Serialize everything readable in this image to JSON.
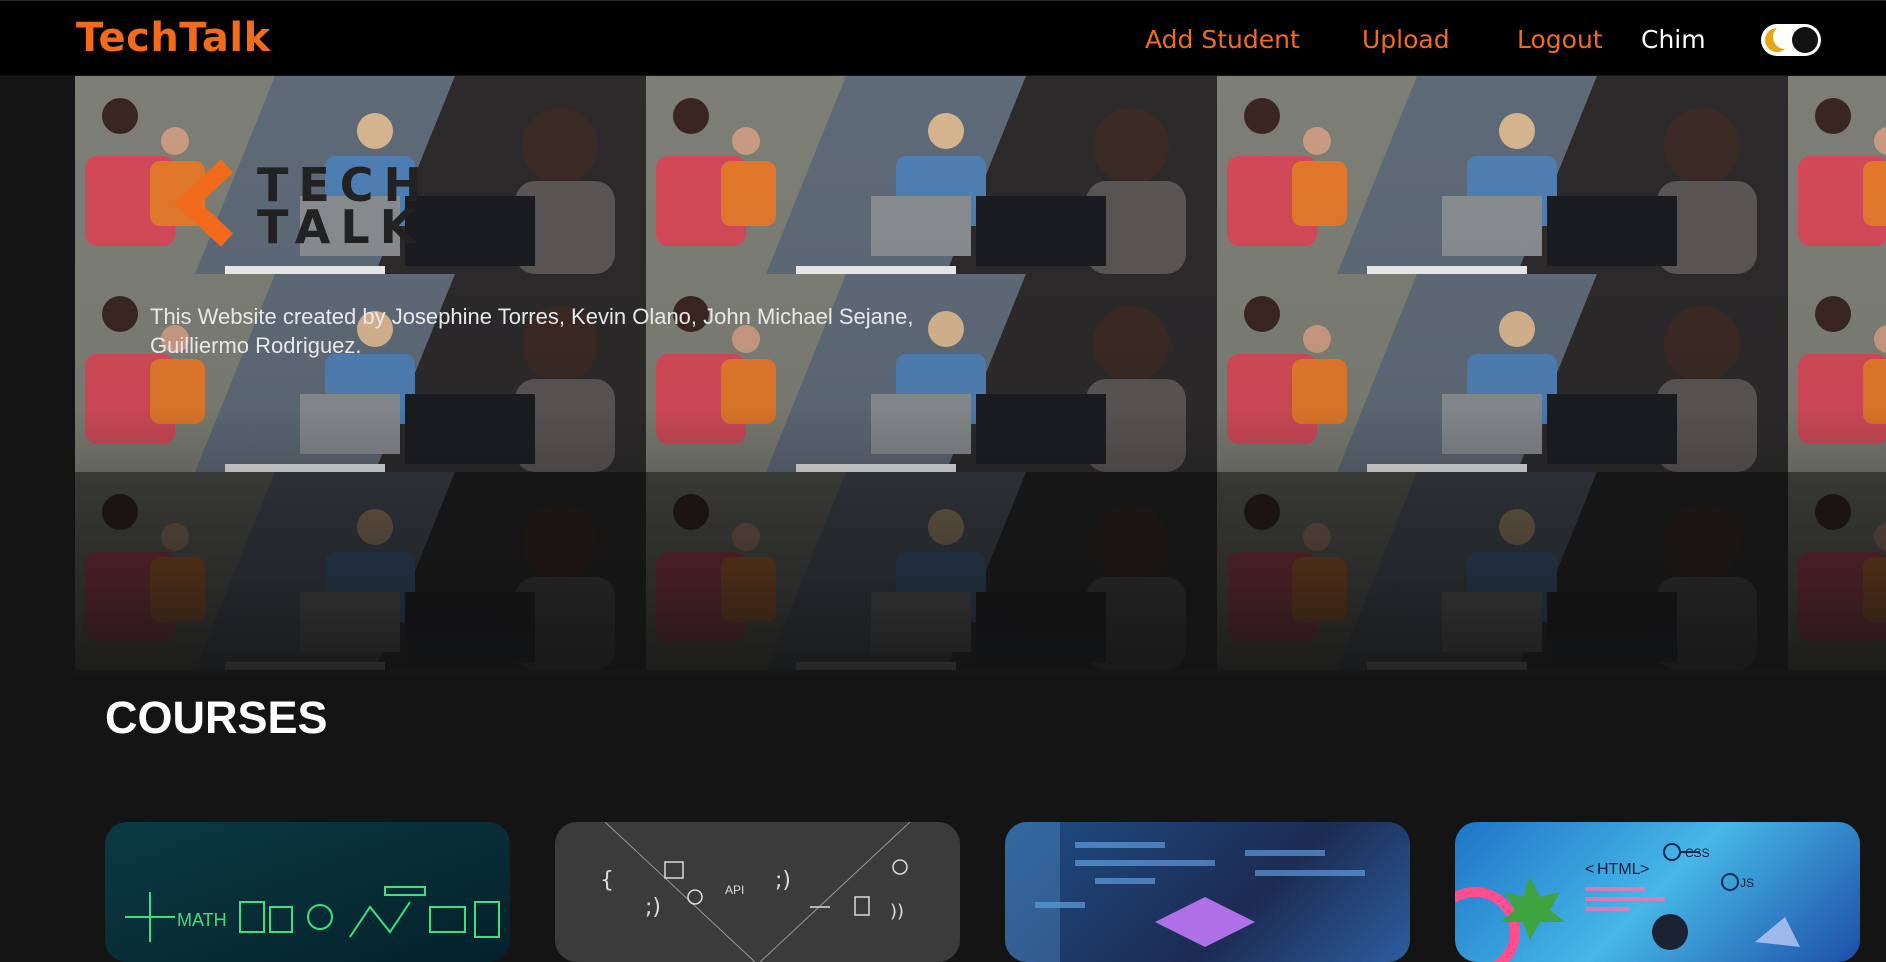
{
  "navbar": {
    "brand": "TechTalk",
    "links": [
      "Add Student",
      "Upload",
      "Logout"
    ],
    "user_name": "Chim",
    "theme_toggle": {
      "state": "dark",
      "icon": "moon-icon"
    }
  },
  "hero": {
    "logo_text": "TECH TALK",
    "credit": "This Website created by Josephine Torres, Kevin Olano, John Michael Sejane, Guilliermo Rodriguez."
  },
  "courses": {
    "title": "COURSES",
    "cards": [
      {
        "label": "MATH"
      },
      {
        "label": "API"
      },
      {
        "label": ""
      },
      {
        "label": "HTML",
        "extra": [
          "CSS",
          "JS"
        ]
      }
    ]
  },
  "colors": {
    "brand": "#f26b1d",
    "navbar_bg": "#000000",
    "page_bg": "#141414",
    "toggle_accent": "#e6a817"
  }
}
